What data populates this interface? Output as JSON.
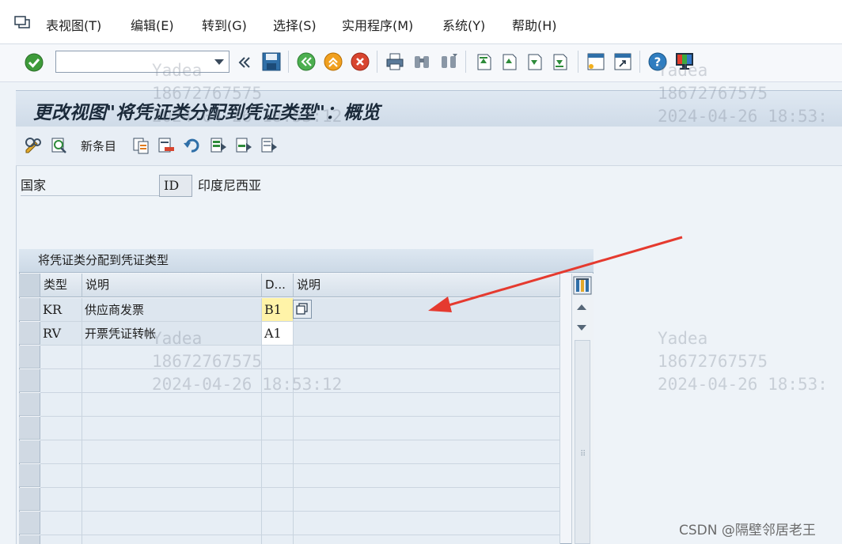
{
  "menu": {
    "items": [
      "表视图(T)",
      "编辑(E)",
      "转到(G)",
      "选择(S)",
      "实用程序(M)",
      "系统(Y)",
      "帮助(H)"
    ]
  },
  "toolbar": {
    "command_value": "",
    "icons": [
      "enter-icon",
      "back-icon",
      "exit-icon",
      "cancel-icon",
      "print-icon",
      "find-icon",
      "find-next-icon",
      "first-page-icon",
      "previous-page-icon",
      "next-page-icon",
      "last-page-icon",
      "create-session-icon",
      "shortcut-icon",
      "help-icon",
      "customize-layout-icon"
    ]
  },
  "title": "更改视图\"将凭证类分配到凭证类型\"：概览",
  "app_toolbar": {
    "new_entries_label": "新条目"
  },
  "header_fields": {
    "country_label": "国家",
    "country_code": "ID",
    "country_name": "印度尼西亚"
  },
  "table": {
    "title": "将凭证类分配到凭证类型",
    "columns": [
      "类型",
      "说明",
      "D...",
      "说明"
    ],
    "rows": [
      {
        "type": "KR",
        "description": "供应商发票",
        "doc_type": "B1",
        "doc_desc": ""
      },
      {
        "type": "RV",
        "description": "开票凭证转帐",
        "doc_type": "A1",
        "doc_desc": ""
      }
    ],
    "empty_row_count": 9
  },
  "watermark": {
    "name": "Yadea",
    "phone": "18672767575",
    "timestamp": "2024-04-26 18:53:12",
    "timestamp_clipped": "2024-04-26 18:53:"
  },
  "footer": {
    "csdn_credit": "CSDN @隔壁邻居老王"
  },
  "colors": {
    "arrow": "#e53a2f",
    "focused_cell": "#fff3a8",
    "title_bar": "#d5e0ec"
  }
}
